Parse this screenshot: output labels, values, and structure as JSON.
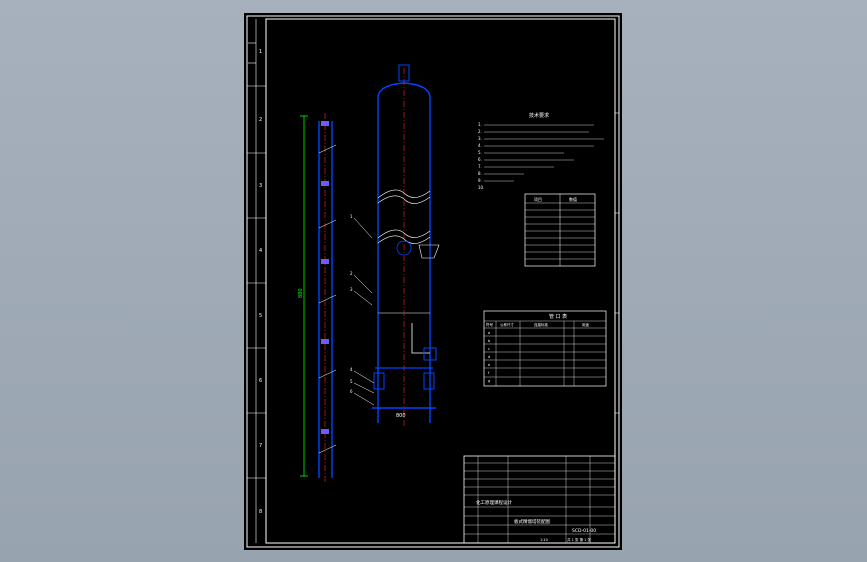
{
  "drawing": {
    "zone_numbers": [
      "1",
      "2",
      "3",
      "4",
      "5",
      "6",
      "7",
      "8"
    ],
    "dimension_height": "880",
    "dimension_base": "800",
    "dimension_top": "500",
    "part_callouts": [
      "1",
      "2",
      "3",
      "4",
      "5",
      "6"
    ],
    "notes_title": "技术要求",
    "notes_lines": [
      "1.",
      "2.",
      "3.",
      "4.",
      "5.",
      "6.",
      "7.",
      "8.",
      "9.",
      "10."
    ],
    "nozzle_table_title": "管 口 表",
    "nozzle_table_headers": [
      "符号",
      "公称尺寸",
      "连接标准",
      "用途"
    ],
    "nozzle_rows": [
      "a",
      "b",
      "c",
      "d",
      "e",
      "f",
      "g",
      "h"
    ],
    "design_table_headers": [
      "项目",
      "数值"
    ],
    "drawing_number": "SCD-01-00",
    "sheet_text": "共 1 张 第 1 张",
    "scale": "1:10",
    "school_title": "化工原理课程设计",
    "drawing_title": "板式精馏塔装配图"
  }
}
